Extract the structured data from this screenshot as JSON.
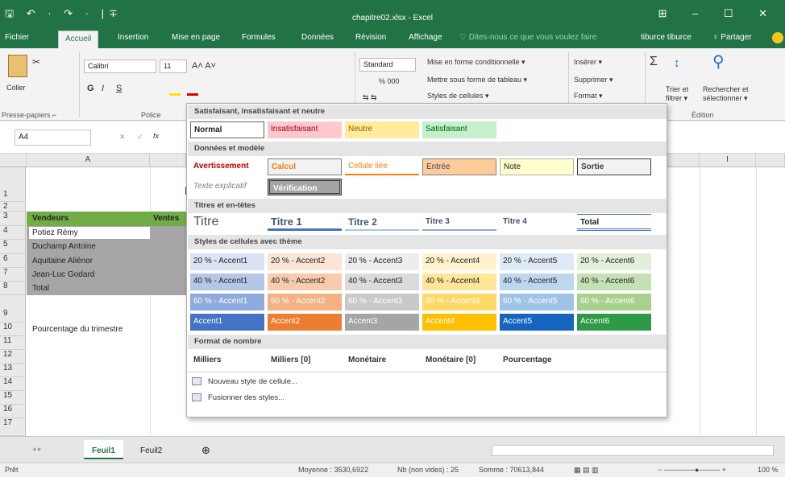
{
  "title_bar": {
    "quick_access": "🖫 ↶ · ↷ · |∓",
    "file_title": "chapitre02.xlsx - Excel",
    "window_controls": "⊞ – ☐ ✕"
  },
  "tabs": [
    "Fichier",
    "Accueil",
    "Insertion",
    "Mise en page",
    "Formules",
    "Données",
    "Révision",
    "Affichage"
  ],
  "tell_me": "♡ Dites-nous ce que vous voulez faire",
  "user": "tiburce tiburce",
  "share": "♀ Partager",
  "ribbon": {
    "paste": "Coller",
    "clipboard_group": "Presse-papiers ⌐",
    "font_name": "Calibri",
    "font_size": "11",
    "grow": "A˄ A˅",
    "bold": "G",
    "italic": "I",
    "underline": "S",
    "font_group": "Police",
    "number_format": "Standard",
    "percent": "% 000",
    "fill_icons": "⇆ ⇆",
    "cond_format": "Mise en forme conditionnelle ▾",
    "format_table": "Mettre sous forme de tableau ▾",
    "cell_styles": "Styles de cellules ▾",
    "insert": "Insérer ▾",
    "delete": "Supprimer ▾",
    "format": "Format ▾",
    "sum": "Σ",
    "sort_filter": "Trier et filtrer ▾",
    "find_select": "Rechercher et sélectionner ▾",
    "edit_group": "Édition"
  },
  "formula_bar": {
    "name_box": "A4",
    "fx": "fx",
    "cancel": "✕",
    "confirm": "✓"
  },
  "sheet": {
    "columns": [
      "A",
      "",
      "",
      "",
      "",
      "",
      "",
      "",
      "",
      "",
      "",
      "I",
      ""
    ],
    "rows": [
      "1",
      "2",
      "3",
      "4",
      "5",
      "6",
      "7",
      "8",
      "9",
      "10",
      "11",
      "12",
      "13",
      "14",
      "15",
      "16",
      "17"
    ],
    "title_fragment": "E",
    "header_vendeurs": "Vendeurs",
    "header_ventes": "Ventes",
    "names": [
      "Potiez Rémy",
      "Duchamp Antoine",
      "Aquitaine Aliénor",
      "Jean-Luc Godard",
      "Total"
    ],
    "pct_label": "Pourcentage du trimestre"
  },
  "gallery": {
    "sec1": "Satisfaisant, insatisfaisant et neutre",
    "good": [
      "Normal",
      "Insatisfaisant",
      "Neutre",
      "Satisfaisant"
    ],
    "sec2": "Données et modèle",
    "data1": [
      "Avertissement",
      "Calcul",
      "Cellule liée",
      "Entrée",
      "Note",
      "Sortie"
    ],
    "data2": [
      "Texte explicatif",
      "Vérification"
    ],
    "sec3": "Titres et en-têtes",
    "titles": [
      "Titre",
      "Titre 1",
      "Titre 2",
      "Titre 3",
      "Titre 4",
      "Total"
    ],
    "sec4": "Styles de cellules avec thème",
    "row20": [
      "20 % - Accent1",
      "20 % - Accent2",
      "20 % - Accent3",
      "20 % - Accent4",
      "20 % - Accent5",
      "20 % - Accent6"
    ],
    "row40": [
      "40 % - Accent1",
      "40 % - Accent2",
      "40 % - Accent3",
      "40 % - Accent4",
      "40 % - Accent5",
      "40 % - Accent6"
    ],
    "row60": [
      "60 % - Accent1",
      "60 % - Accent2",
      "60 % - Accent3",
      "60 % - Accent4",
      "60 % - Accent5",
      "60 % - Accent6"
    ],
    "rowacc": [
      "Accent1",
      "Accent2",
      "Accent3",
      "Accent4",
      "Accent5",
      "Accent6"
    ],
    "sec5": "Format de nombre",
    "numfmt": [
      "Milliers",
      "Milliers [0]",
      "Monétaire",
      "Monétaire [0]",
      "Pourcentage"
    ],
    "new_style": "Nouveau style de cellule...",
    "merge_styles": "Fusionner des styles..."
  },
  "sheet_tabs": [
    "Feuil1",
    "Feuil2",
    "⊕"
  ],
  "status": {
    "ready": "Prêt",
    "avg": "Moyenne : 3530,6922",
    "count": "Nb (non vides) : 25",
    "sum": "Somme : 70613,844",
    "zoom": "100 %"
  },
  "colors": {
    "excel_green": "#217346",
    "accent1": "#4472c4",
    "accent2": "#ed7d31",
    "accent3": "#a5a5a5",
    "accent4": "#ffc000",
    "accent5": "#5b9bd5",
    "accent6": "#70ad47"
  }
}
